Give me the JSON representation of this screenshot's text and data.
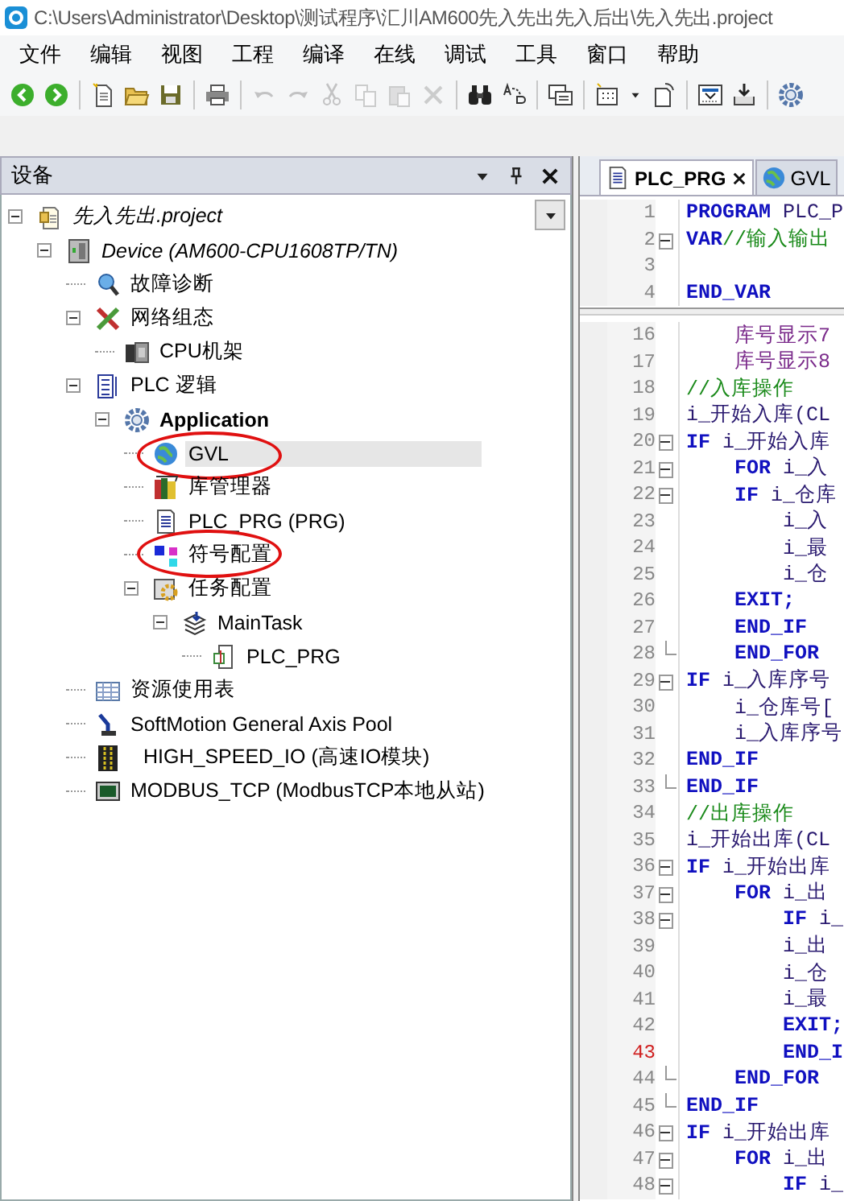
{
  "window": {
    "title": "C:\\Users\\Administrator\\Desktop\\测试程序\\汇川AM600先入先出先入后出\\先入先出.project"
  },
  "menu": [
    "文件",
    "编辑",
    "视图",
    "工程",
    "编译",
    "在线",
    "调试",
    "工具",
    "窗口",
    "帮助"
  ],
  "toolbar": [
    [
      {
        "kind": "back",
        "disabled": false
      },
      {
        "kind": "forward",
        "disabled": false
      }
    ],
    [
      {
        "kind": "new",
        "disabled": false
      },
      {
        "kind": "open",
        "disabled": false
      },
      {
        "kind": "save",
        "disabled": false
      }
    ],
    [
      {
        "kind": "print",
        "disabled": false
      }
    ],
    [
      {
        "kind": "undo",
        "disabled": true
      },
      {
        "kind": "redo",
        "disabled": true
      },
      {
        "kind": "cut",
        "disabled": true
      },
      {
        "kind": "copy",
        "disabled": true
      },
      {
        "kind": "paste",
        "disabled": true
      },
      {
        "kind": "delete",
        "disabled": true
      }
    ],
    [
      {
        "kind": "find",
        "disabled": false
      },
      {
        "kind": "replace",
        "disabled": false
      }
    ],
    [
      {
        "kind": "window",
        "disabled": false
      }
    ],
    [
      {
        "kind": "grid",
        "disabled": false
      },
      {
        "kind": "caret",
        "disabled": false
      },
      {
        "kind": "page",
        "disabled": false
      }
    ],
    [
      {
        "kind": "download",
        "disabled": false
      },
      {
        "kind": "import",
        "disabled": false
      }
    ],
    [
      {
        "kind": "gear",
        "disabled": false
      }
    ]
  ],
  "devices_panel": {
    "title": "设备",
    "tree": [
      {
        "label": "先入先出.project",
        "kind": "project",
        "expanded": true,
        "selected": false,
        "circled": false,
        "children": [
          {
            "label": "Device (AM600-CPU1608TP/TN)",
            "kind": "device",
            "expanded": true,
            "selected": false,
            "circled": false,
            "children": [
              {
                "label": "故障诊断",
                "kind": "diagnostics",
                "selected": false,
                "circled": false
              },
              {
                "label": "网络组态",
                "kind": "network",
                "expanded": true,
                "selected": false,
                "circled": false,
                "children": [
                  {
                    "label": "CPU机架",
                    "kind": "rack",
                    "selected": false,
                    "circled": false
                  }
                ]
              },
              {
                "label": "PLC 逻辑",
                "kind": "logic",
                "expanded": true,
                "selected": false,
                "circled": false,
                "children": [
                  {
                    "label": "Application",
                    "kind": "application",
                    "expanded": true,
                    "selected": false,
                    "circled": false,
                    "children": [
                      {
                        "label": "GVL",
                        "kind": "gvl",
                        "selected": true,
                        "circled": true
                      },
                      {
                        "label": "库管理器",
                        "kind": "library",
                        "selected": false,
                        "circled": false
                      },
                      {
                        "label": "PLC_PRG (PRG)",
                        "kind": "pou",
                        "selected": false,
                        "circled": false
                      },
                      {
                        "label": "符号配置",
                        "kind": "symbols",
                        "selected": false,
                        "circled": true
                      },
                      {
                        "label": "任务配置",
                        "kind": "taskconfig",
                        "expanded": true,
                        "selected": false,
                        "circled": false,
                        "children": [
                          {
                            "label": "MainTask",
                            "kind": "task",
                            "expanded": true,
                            "selected": false,
                            "circled": false,
                            "children": [
                              {
                                "label": "PLC_PRG",
                                "kind": "taskcall",
                                "selected": false,
                                "circled": false
                              }
                            ]
                          }
                        ]
                      }
                    ]
                  }
                ]
              },
              {
                "label": "资源使用表",
                "kind": "resources",
                "selected": false,
                "circled": false
              },
              {
                "label": "SoftMotion General Axis Pool",
                "kind": "axispool",
                "selected": false,
                "circled": false
              },
              {
                "label": "HIGH_SPEED_IO (高速IO模块)",
                "kind": "io",
                "selected": false,
                "circled": false
              },
              {
                "label": "MODBUS_TCP (ModbusTCP本地从站)",
                "kind": "modbus",
                "selected": false,
                "circled": false
              }
            ]
          }
        ]
      }
    ]
  },
  "editor": {
    "tabs": [
      {
        "label": "PLC_PRG",
        "kind": "pou",
        "selected": true,
        "closable": true
      },
      {
        "label": "GVL",
        "kind": "gvl",
        "selected": false,
        "closable": false
      }
    ],
    "header_lines": [
      {
        "number": "1",
        "kind": "plain",
        "highlight": false,
        "tokens": [
          {
            "text": "PROGRAM ",
            "kind": "kw"
          },
          {
            "text": "PLC_P",
            "kind": "id"
          }
        ]
      },
      {
        "number": "2",
        "kind": "fold_start",
        "highlight": false,
        "tokens": [
          {
            "text": "VAR",
            "kind": "kw"
          },
          {
            "text": "//输入输出",
            "kind": "cm"
          }
        ]
      },
      {
        "number": "3",
        "kind": "plain",
        "highlight": false
      },
      {
        "number": "4",
        "kind": "plain",
        "highlight": false,
        "tokens": [
          {
            "text": "END_VAR",
            "kind": "kw"
          }
        ]
      }
    ],
    "body_lines": [
      {
        "number": "16",
        "kind": "plain",
        "highlight": false,
        "tokens": [
          {
            "text": "    库号显示7",
            "kind": "var"
          }
        ]
      },
      {
        "number": "17",
        "kind": "plain",
        "highlight": false,
        "tokens": [
          {
            "text": "    库号显示8",
            "kind": "var"
          }
        ]
      },
      {
        "number": "18",
        "kind": "plain",
        "highlight": false,
        "tokens": [
          {
            "text": "//入库操作",
            "kind": "cm"
          }
        ]
      },
      {
        "number": "19",
        "kind": "plain",
        "highlight": false,
        "tokens": [
          {
            "text": "i_开始入库(CL",
            "kind": "id"
          }
        ]
      },
      {
        "number": "20",
        "kind": "fold_start",
        "highlight": false,
        "tokens": [
          {
            "text": "IF ",
            "kind": "kw"
          },
          {
            "text": "i_开始入库",
            "kind": "id"
          }
        ]
      },
      {
        "number": "21",
        "kind": "fold_start",
        "highlight": false,
        "tokens": [
          {
            "text": "    FOR ",
            "kind": "kw"
          },
          {
            "text": "i_入",
            "kind": "id"
          }
        ]
      },
      {
        "number": "22",
        "kind": "fold_start",
        "highlight": false,
        "tokens": [
          {
            "text": "    IF ",
            "kind": "kw"
          },
          {
            "text": "i_仓库",
            "kind": "id"
          }
        ]
      },
      {
        "number": "23",
        "kind": "plain",
        "highlight": false,
        "tokens": [
          {
            "text": "        i_入",
            "kind": "id"
          }
        ]
      },
      {
        "number": "24",
        "kind": "plain",
        "highlight": false,
        "tokens": [
          {
            "text": "        i_最",
            "kind": "id"
          }
        ]
      },
      {
        "number": "25",
        "kind": "plain",
        "highlight": false,
        "tokens": [
          {
            "text": "        i_仓",
            "kind": "id"
          }
        ]
      },
      {
        "number": "26",
        "kind": "plain",
        "highlight": false,
        "tokens": [
          {
            "text": "    EXIT;",
            "kind": "kw"
          }
        ]
      },
      {
        "number": "27",
        "kind": "plain",
        "highlight": false,
        "tokens": [
          {
            "text": "    END_IF",
            "kind": "kw"
          }
        ]
      },
      {
        "number": "28",
        "kind": "fold_end",
        "highlight": false,
        "tokens": [
          {
            "text": "    END_FOR",
            "kind": "kw"
          }
        ]
      },
      {
        "number": "29",
        "kind": "fold_start",
        "highlight": false,
        "tokens": [
          {
            "text": "IF ",
            "kind": "kw"
          },
          {
            "text": "i_入库序号",
            "kind": "id"
          }
        ]
      },
      {
        "number": "30",
        "kind": "plain",
        "highlight": false,
        "tokens": [
          {
            "text": "    i_仓库号[",
            "kind": "id"
          }
        ]
      },
      {
        "number": "31",
        "kind": "plain",
        "highlight": false,
        "tokens": [
          {
            "text": "    i_入库序号",
            "kind": "id"
          }
        ]
      },
      {
        "number": "32",
        "kind": "plain",
        "highlight": false,
        "tokens": [
          {
            "text": "END_IF",
            "kind": "kw"
          }
        ]
      },
      {
        "number": "33",
        "kind": "fold_end",
        "highlight": false,
        "tokens": [
          {
            "text": "END_IF",
            "kind": "kw"
          }
        ]
      },
      {
        "number": "34",
        "kind": "plain",
        "highlight": false,
        "tokens": [
          {
            "text": "//出库操作",
            "kind": "cm"
          }
        ]
      },
      {
        "number": "35",
        "kind": "plain",
        "highlight": false,
        "tokens": [
          {
            "text": "i_开始出库(CL",
            "kind": "id"
          }
        ]
      },
      {
        "number": "36",
        "kind": "fold_start",
        "highlight": false,
        "tokens": [
          {
            "text": "IF ",
            "kind": "kw"
          },
          {
            "text": "i_开始出库",
            "kind": "id"
          }
        ]
      },
      {
        "number": "37",
        "kind": "fold_start",
        "highlight": false,
        "tokens": [
          {
            "text": "    FOR ",
            "kind": "kw"
          },
          {
            "text": "i_出",
            "kind": "id"
          }
        ]
      },
      {
        "number": "38",
        "kind": "fold_start",
        "highlight": false,
        "tokens": [
          {
            "text": "        IF ",
            "kind": "kw"
          },
          {
            "text": "i_",
            "kind": "id"
          }
        ]
      },
      {
        "number": "39",
        "kind": "plain",
        "highlight": false,
        "tokens": [
          {
            "text": "        i_出",
            "kind": "id"
          }
        ]
      },
      {
        "number": "40",
        "kind": "plain",
        "highlight": false,
        "tokens": [
          {
            "text": "        i_仓",
            "kind": "id"
          }
        ]
      },
      {
        "number": "41",
        "kind": "plain",
        "highlight": false,
        "tokens": [
          {
            "text": "        i_最",
            "kind": "id"
          }
        ]
      },
      {
        "number": "42",
        "kind": "plain",
        "highlight": false,
        "tokens": [
          {
            "text": "        EXIT;",
            "kind": "kw"
          }
        ]
      },
      {
        "number": "43",
        "kind": "plain",
        "highlight": true,
        "tokens": [
          {
            "text": "        END_I",
            "kind": "kw"
          }
        ]
      },
      {
        "number": "44",
        "kind": "fold_end",
        "highlight": false,
        "tokens": [
          {
            "text": "    END_FOR",
            "kind": "kw"
          }
        ]
      },
      {
        "number": "45",
        "kind": "fold_end",
        "highlight": false,
        "tokens": [
          {
            "text": "END_IF",
            "kind": "kw"
          }
        ]
      },
      {
        "number": "46",
        "kind": "fold_start",
        "highlight": false,
        "tokens": [
          {
            "text": "IF ",
            "kind": "kw"
          },
          {
            "text": "i_开始出库",
            "kind": "id"
          }
        ]
      },
      {
        "number": "47",
        "kind": "fold_start",
        "highlight": false,
        "tokens": [
          {
            "text": "    FOR ",
            "kind": "kw"
          },
          {
            "text": "i_出",
            "kind": "id"
          }
        ]
      },
      {
        "number": "48",
        "kind": "fold_start",
        "highlight": false,
        "tokens": [
          {
            "text": "        IF ",
            "kind": "kw"
          },
          {
            "text": "i_",
            "kind": "id"
          }
        ]
      }
    ]
  }
}
